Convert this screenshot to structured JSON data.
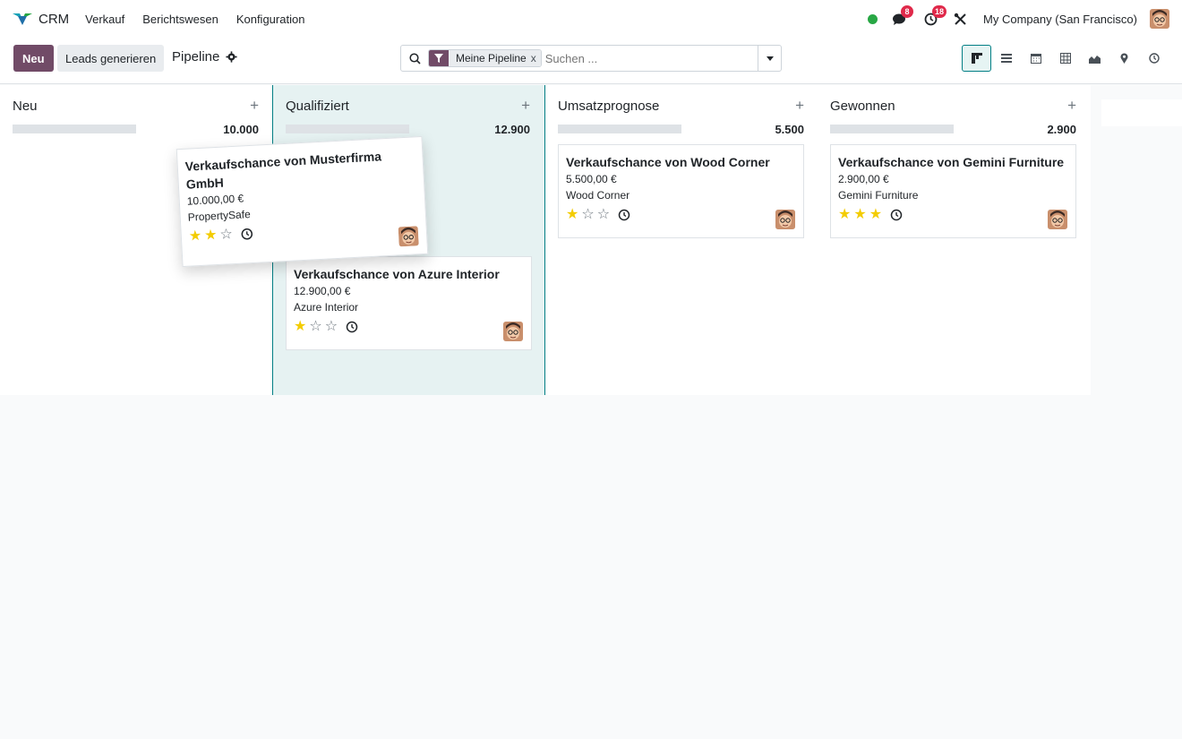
{
  "nav": {
    "app_name": "CRM",
    "menu": [
      "Verkauf",
      "Berichtswesen",
      "Konfiguration"
    ],
    "messages_count": "8",
    "activities_count": "18",
    "company": "My Company (San Francisco)",
    "presence_color": "#28a745"
  },
  "control_panel": {
    "new_button": "Neu",
    "generate_button": "Leads generieren",
    "breadcrumb": "Pipeline",
    "search": {
      "facet_label": "Meine Pipeline",
      "facet_remove": "x",
      "placeholder": "Suchen ..."
    },
    "views": [
      "kanban-view-icon",
      "list-view-icon",
      "calendar-view-icon",
      "pivot-view-icon",
      "graph-view-icon",
      "map-view-icon",
      "activity-view-icon"
    ],
    "active_view": "kanban"
  },
  "columns": [
    {
      "title": "Neu",
      "add": "+",
      "total": "10.000"
    },
    {
      "title": "Qualifiziert",
      "add": "+",
      "total": "12.900"
    },
    {
      "title": "Umsatzprognose",
      "add": "+",
      "total": "5.500"
    },
    {
      "title": "Gewonnen",
      "add": "+",
      "total": "2.900"
    }
  ],
  "cards": {
    "dragged": {
      "title": "Verkaufschance von Musterfirma GmbH",
      "amount": "10.000,00 €",
      "company": "PropertySafe",
      "stars": 2
    },
    "azure": {
      "title": "Verkaufschance von Azure Interior",
      "amount": "12.900,00 €",
      "company": "Azure Interior",
      "stars": 1
    },
    "wood": {
      "title": "Verkaufschance von Wood Corner",
      "amount": "5.500,00 €",
      "company": "Wood Corner",
      "stars": 1
    },
    "gemini": {
      "title": "Verkaufschance von Gemini Furniture",
      "amount": "2.900,00 €",
      "company": "Gemini Furniture",
      "stars": 3
    }
  },
  "colors": {
    "primary": "#714b67",
    "accent": "#017e84",
    "star": "#f3cc00",
    "badge": "#e0294a"
  }
}
